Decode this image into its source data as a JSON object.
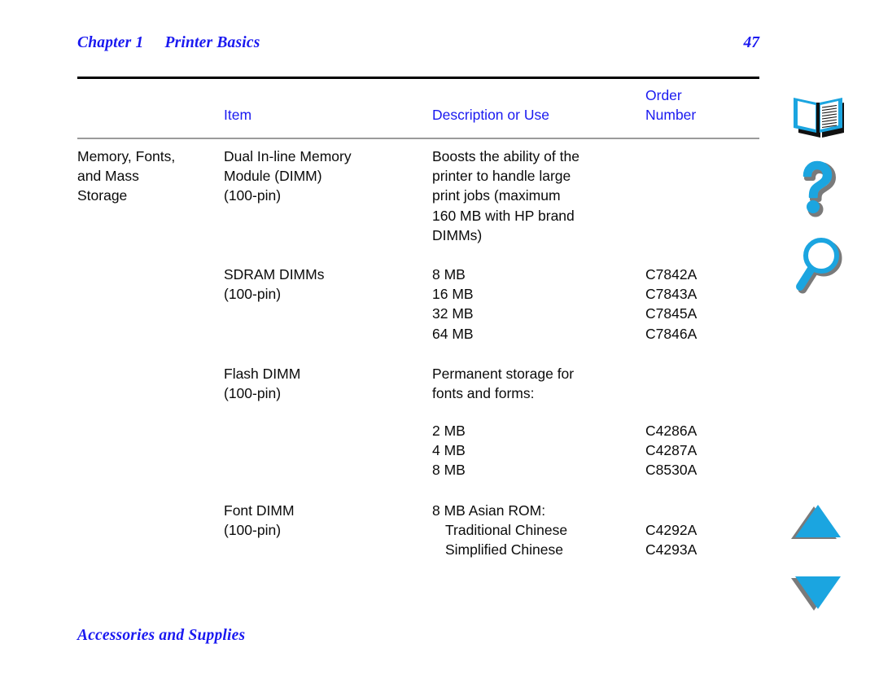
{
  "header": {
    "chapter": "Chapter 1",
    "chapter_title": "Printer Basics",
    "page_number": "47"
  },
  "footer": {
    "section_title": "Accessories and Supplies"
  },
  "colors": {
    "heading_blue": "#1a19f0",
    "icon_cyan": "#1ba5e0",
    "icon_shadow": "#7a7a7a",
    "rule_black": "#000000",
    "rule_gray": "#9b9b9b",
    "body_text": "#0b0b0b"
  },
  "table": {
    "columns": [
      {
        "key": "item",
        "label": "Item"
      },
      {
        "key": "description",
        "label": "Description or Use"
      },
      {
        "key": "order_number",
        "label": "Order\nNumber"
      }
    ],
    "rows": [
      {
        "item": "Memory, Fonts,\nand Mass\nStorage",
        "subitem": "Dual In-line Memory\nModule (DIMM)\n(100-pin)",
        "description": "Boosts the ability of the\nprinter to handle large\nprint jobs (maximum\n160 MB with HP brand\nDIMMs)",
        "order_number": ""
      },
      {
        "item": "",
        "subitem": "SDRAM DIMMs\n(100-pin)",
        "description": "8 MB\n16 MB\n32 MB\n64 MB",
        "order_number": "C7842A\nC7843A\nC7845A\nC7846A"
      },
      {
        "item": "",
        "subitem": "Flash DIMM\n(100-pin)",
        "description": "Permanent storage for\nfonts and forms:",
        "order_number": ""
      },
      {
        "item": "",
        "subitem": "",
        "description": "2 MB\n4 MB\n8 MB",
        "order_number": "C4286A\nC4287A\nC8530A"
      },
      {
        "item": "",
        "subitem": "Font DIMM\n(100-pin)",
        "description": "8 MB Asian ROM:",
        "order_number": ""
      },
      {
        "item": "",
        "subitem": "",
        "description": "Traditional Chinese\nSimplified Chinese",
        "order_number": "C4292A\nC4293A"
      }
    ]
  },
  "nav_rail": {
    "book": {
      "icon": "open-book-icon",
      "label": "Contents"
    },
    "help": {
      "icon": "question-mark-icon",
      "label": "Help"
    },
    "search": {
      "icon": "magnifying-glass-icon",
      "label": "Search"
    },
    "previous": {
      "icon": "triangle-up-icon",
      "label": "Previous page"
    },
    "next": {
      "icon": "triangle-down-icon",
      "label": "Next page"
    }
  }
}
